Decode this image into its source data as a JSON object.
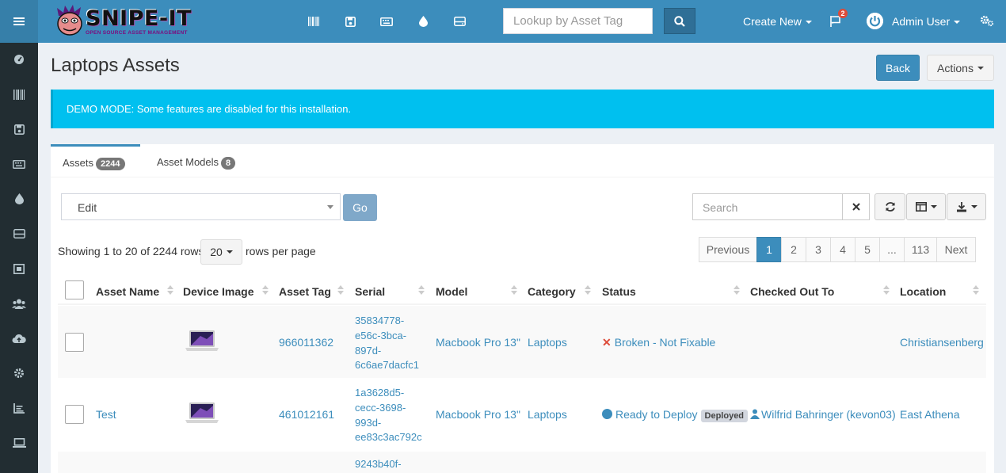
{
  "header": {
    "logo_text": "SNIPE-IT",
    "logo_sub": "OPEN SOURCE ASSET MANAGEMENT",
    "lookup_placeholder": "Lookup by Asset Tag",
    "create_new": "Create New",
    "notification_count": "2",
    "user_name": "Admin User",
    "accent": "#3c8dbc"
  },
  "toolbar_icons": [
    "barcode-icon",
    "save-icon",
    "keyboard-icon",
    "drop-icon",
    "hdd-icon"
  ],
  "sidebar_icons": [
    "dashboard-icon",
    "barcode-icon",
    "save-icon",
    "keyboard-icon",
    "drop-icon",
    "hdd-icon",
    "kit-icon",
    "users-icon",
    "cloud-upload-icon",
    "settings-icon",
    "reports-icon",
    "laptop-icon"
  ],
  "page": {
    "title": "Laptops Assets",
    "back_label": "Back",
    "actions_label": "Actions"
  },
  "alert": {
    "text": "DEMO MODE: Some features are disabled for this installation."
  },
  "tabs": [
    {
      "label": "Assets",
      "count": "2244"
    },
    {
      "label": "Asset Models",
      "count": "8"
    }
  ],
  "table_controls": {
    "bulk_action": "Edit",
    "go_label": "Go",
    "search_placeholder": "Search",
    "showing": "Showing 1 to 20 of 2244 rows",
    "page_size": "20",
    "rows_per_page": "rows per page"
  },
  "pagination": [
    "Previous",
    "1",
    "2",
    "3",
    "4",
    "5",
    "...",
    "113",
    "Next"
  ],
  "columns": [
    "Asset Name",
    "Device Image",
    "Asset Tag",
    "Serial",
    "Model",
    "Category",
    "Status",
    "Checked Out To",
    "Location"
  ],
  "rows": [
    {
      "asset_name": "",
      "asset_tag": "966011362",
      "serial": [
        "35834778-",
        "e56c-3bca-",
        "897d-",
        "6c6ae7dacfc1"
      ],
      "model": "Macbook Pro 13\"",
      "category": "Laptops",
      "status": "Broken - Not Fixable",
      "status_badge": "",
      "checked_out_to": "",
      "location": "Christiansenberg"
    },
    {
      "asset_name": "Test",
      "asset_tag": "461012161",
      "serial": [
        "1a3628d5-",
        "cecc-3698-",
        "993d-",
        "ee83c3ac792c"
      ],
      "model": "Macbook Pro 13\"",
      "category": "Laptops",
      "status": "Ready to Deploy",
      "status_badge": "Deployed",
      "checked_out_to": "Wilfrid Bahringer (kevon03)",
      "location": "East Athena"
    },
    {
      "serial": [
        "9243b40f-"
      ]
    }
  ]
}
